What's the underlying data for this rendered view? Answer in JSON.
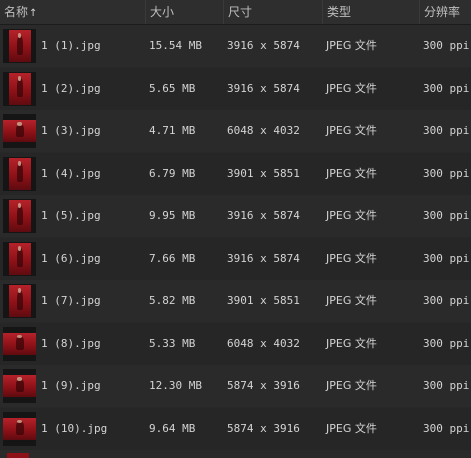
{
  "columns": {
    "name": "名称",
    "size": "大小",
    "dimensions": "尺寸",
    "type": "类型",
    "resolution": "分辨率"
  },
  "sort_indicator": "arrow-up-icon",
  "accent_color": "#a8161e",
  "files": [
    {
      "name": "1 (1).jpg",
      "size": "15.54 MB",
      "dimensions": "3916 x 5874",
      "type": "JPEG 文件",
      "resolution": "300 ppi",
      "orientation": "portrait"
    },
    {
      "name": "1 (2).jpg",
      "size": "5.65 MB",
      "dimensions": "3916 x 5874",
      "type": "JPEG 文件",
      "resolution": "300 ppi",
      "orientation": "portrait"
    },
    {
      "name": "1 (3).jpg",
      "size": "4.71 MB",
      "dimensions": "6048 x 4032",
      "type": "JPEG 文件",
      "resolution": "300 ppi",
      "orientation": "landscape"
    },
    {
      "name": "1 (4).jpg",
      "size": "6.79 MB",
      "dimensions": "3901 x 5851",
      "type": "JPEG 文件",
      "resolution": "300 ppi",
      "orientation": "portrait"
    },
    {
      "name": "1 (5).jpg",
      "size": "9.95 MB",
      "dimensions": "3916 x 5874",
      "type": "JPEG 文件",
      "resolution": "300 ppi",
      "orientation": "portrait"
    },
    {
      "name": "1 (6).jpg",
      "size": "7.66 MB",
      "dimensions": "3916 x 5874",
      "type": "JPEG 文件",
      "resolution": "300 ppi",
      "orientation": "portrait"
    },
    {
      "name": "1 (7).jpg",
      "size": "5.82 MB",
      "dimensions": "3901 x 5851",
      "type": "JPEG 文件",
      "resolution": "300 ppi",
      "orientation": "portrait"
    },
    {
      "name": "1 (8).jpg",
      "size": "5.33 MB",
      "dimensions": "6048 x 4032",
      "type": "JPEG 文件",
      "resolution": "300 ppi",
      "orientation": "landscape"
    },
    {
      "name": "1 (9).jpg",
      "size": "12.30 MB",
      "dimensions": "5874 x 3916",
      "type": "JPEG 文件",
      "resolution": "300 ppi",
      "orientation": "landscape"
    },
    {
      "name": "1 (10).jpg",
      "size": "9.64 MB",
      "dimensions": "5874 x 3916",
      "type": "JPEG 文件",
      "resolution": "300 ppi",
      "orientation": "landscape"
    }
  ]
}
